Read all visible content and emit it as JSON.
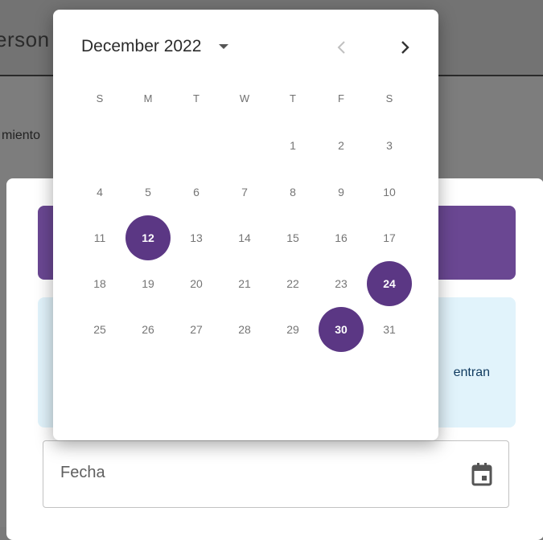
{
  "background": {
    "title_fragment": "erson",
    "text_fragment": "miento"
  },
  "dialog": {
    "info_text_fragment": "entran",
    "date_field": {
      "label": "Fecha",
      "icon": "calendar-icon"
    }
  },
  "picker": {
    "month_label": "December 2022",
    "prev_icon": "chevron-left-icon",
    "next_icon": "chevron-right-icon",
    "weekdays": [
      "S",
      "M",
      "T",
      "W",
      "T",
      "F",
      "S"
    ],
    "weeks": [
      [
        "",
        "",
        "",
        "",
        "1",
        "2",
        "3"
      ],
      [
        "4",
        "5",
        "6",
        "7",
        "8",
        "9",
        "10"
      ],
      [
        "11",
        "12",
        "13",
        "14",
        "15",
        "16",
        "17"
      ],
      [
        "18",
        "19",
        "20",
        "21",
        "22",
        "23",
        "24"
      ],
      [
        "25",
        "26",
        "27",
        "28",
        "29",
        "30",
        "31"
      ]
    ],
    "selected_days": [
      "12",
      "24",
      "30"
    ],
    "accent_color": "#5b3784"
  }
}
